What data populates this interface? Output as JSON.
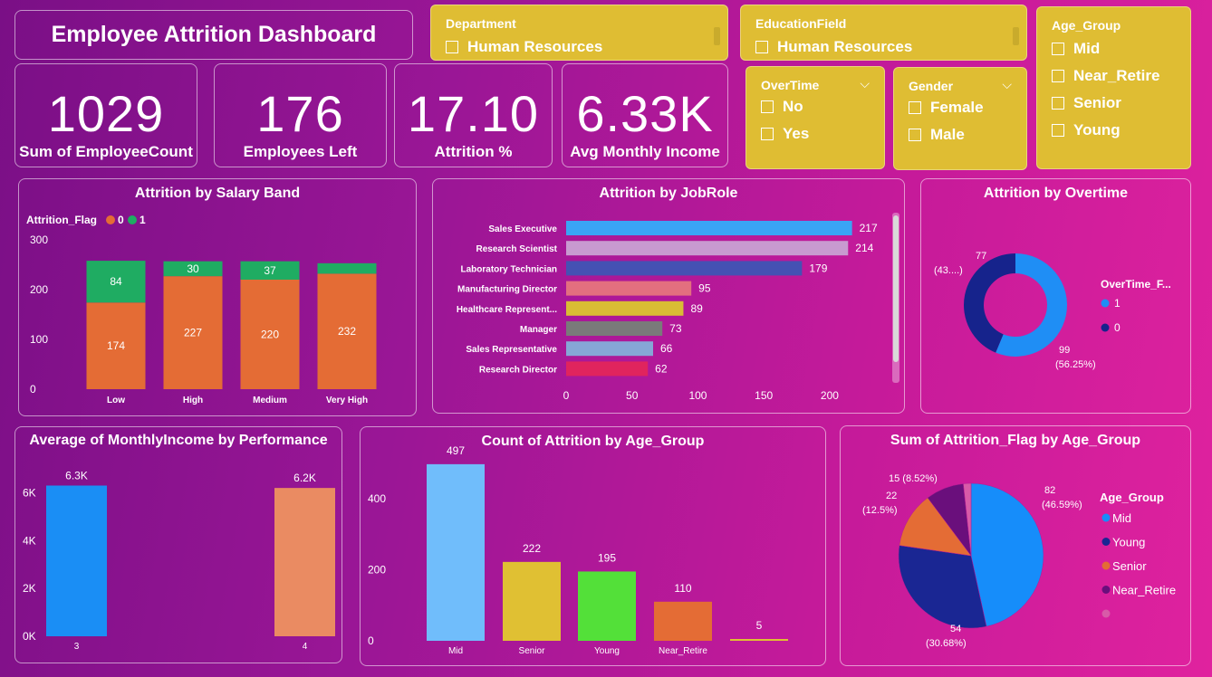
{
  "header": {
    "title": "Employee Attrition Dashboard"
  },
  "kpis": [
    {
      "value": "1029",
      "label": "Sum of EmployeeCount"
    },
    {
      "value": "176",
      "label": "Employees Left"
    },
    {
      "value": "17.10",
      "label": "Attrition %"
    },
    {
      "value": "6.33K",
      "label": "Avg Monthly Income"
    }
  ],
  "slicers": {
    "department": {
      "title": "Department",
      "option": "Human Resources"
    },
    "education": {
      "title": "EducationField",
      "option": "Human Resources"
    },
    "age_group": {
      "title": "Age_Group",
      "options": [
        "Mid",
        "Near_Retire",
        "Senior",
        "Young"
      ]
    },
    "overtime": {
      "title": "OverTime",
      "options": [
        "No",
        "Yes"
      ]
    },
    "gender": {
      "title": "Gender",
      "options": [
        "Female",
        "Male"
      ]
    }
  },
  "colors": {
    "orange": "#e46c35",
    "green": "#1fac62"
  },
  "chart_data": [
    {
      "id": "salary",
      "type": "bar",
      "title": "Attrition by Salary Band",
      "legend_title": "Attrition_Flag",
      "categories": [
        "Low",
        "High",
        "Medium",
        "Very High"
      ],
      "series": [
        {
          "name": "0",
          "values": [
            174,
            227,
            220,
            232
          ],
          "color": "#e46c35"
        },
        {
          "name": "1",
          "values": [
            84,
            30,
            37,
            21
          ],
          "color": "#1fac62"
        }
      ],
      "data_labels": [
        [
          "174",
          "227",
          "220",
          "232"
        ],
        [
          "84",
          "30",
          "37",
          ""
        ]
      ],
      "yticks": [
        "0",
        "100",
        "200",
        "300"
      ],
      "ylim": [
        0,
        300
      ]
    },
    {
      "id": "jobrole",
      "type": "bar",
      "title": "Attrition by JobRole",
      "categories": [
        "Sales Executive",
        "Research Scientist",
        "Laboratory Technician",
        "Manufacturing Director",
        "Healthcare Represent...",
        "Manager",
        "Sales Representative",
        "Research Director"
      ],
      "values": [
        217,
        214,
        179,
        95,
        89,
        73,
        66,
        62
      ],
      "colors": [
        "#3aa4f5",
        "#c89ad0",
        "#4551b3",
        "#e36f7f",
        "#d9bd34",
        "#7a7a7a",
        "#86a6d6",
        "#e0245e"
      ],
      "xticks": [
        "0",
        "50",
        "100",
        "150",
        "200"
      ],
      "xlim": [
        0,
        220
      ]
    },
    {
      "id": "overtime",
      "type": "pie",
      "title": "Attrition by Overtime",
      "legend_title": "OverTime_F...",
      "slices": [
        {
          "name": "1",
          "value": 99,
          "label_value": "99",
          "label_pct": "(56.25%)",
          "color": "#1f8ef5"
        },
        {
          "name": "0",
          "value": 77,
          "label_value": "77",
          "label_pct": "(43....)",
          "color": "#16238c"
        }
      ]
    },
    {
      "id": "performance",
      "type": "bar",
      "title": "Average of MonthlyIncome by Performance",
      "categories": [
        "3",
        "4"
      ],
      "values": [
        6300,
        6200
      ],
      "value_labels": [
        "6.3K",
        "6.2K"
      ],
      "colors": [
        "#1a8ef5",
        "#ea8b62"
      ],
      "yticks": [
        "0K",
        "2K",
        "4K",
        "6K"
      ],
      "ylim": [
        0,
        7000
      ]
    },
    {
      "id": "agecount",
      "type": "bar",
      "title": "Count of Attrition by Age_Group",
      "categories": [
        "Mid",
        "Senior",
        "Young",
        "Near_Retire",
        ""
      ],
      "values": [
        497,
        222,
        195,
        110,
        5
      ],
      "value_labels": [
        "497",
        "222",
        "195",
        "110",
        "5"
      ],
      "colors": [
        "#70bdfb",
        "#e0c033",
        "#53e039",
        "#e46c35",
        "#e0c033"
      ],
      "yticks": [
        "0",
        "200",
        "400"
      ],
      "ylim": [
        0,
        540
      ]
    },
    {
      "id": "agesum",
      "type": "pie",
      "title": "Sum of Attrition_Flag by Age_Group",
      "legend_title": "Age_Group",
      "slices": [
        {
          "name": "Mid",
          "value": 82,
          "label_value": "82",
          "label_pct": "(46.59%)",
          "color": "#168dfa"
        },
        {
          "name": "Young",
          "value": 54,
          "label_value": "54",
          "label_pct": "(30.68%)",
          "color": "#1a2693"
        },
        {
          "name": "Senior",
          "value": 22,
          "label_value": "22",
          "label_pct": "(12.5%)",
          "color": "#e46c35"
        },
        {
          "name": "Near_Retire",
          "value": 15,
          "label_value": "15 (8.52%)",
          "label_pct": "",
          "color": "#6a0f7c"
        },
        {
          "name": "",
          "value": 3,
          "label_value": "",
          "label_pct": "",
          "color": "#d85aa8"
        }
      ]
    }
  ]
}
